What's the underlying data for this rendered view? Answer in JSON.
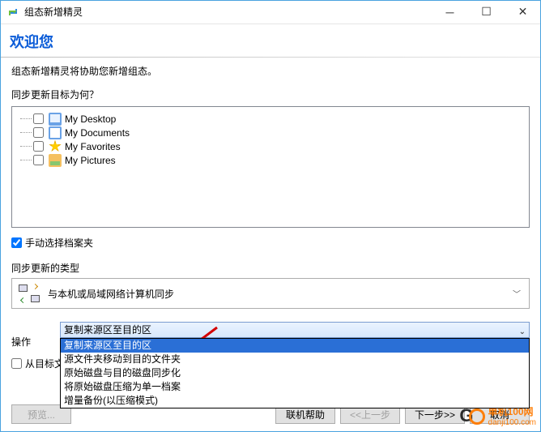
{
  "titlebar": {
    "title": "组态新增精灵"
  },
  "header": {
    "welcome": "欢迎您"
  },
  "intro": "组态新增精灵将协助您新增组态。",
  "section1_label": "同步更新目标为何？",
  "tree": [
    {
      "label": "My Desktop",
      "icon": "desktop"
    },
    {
      "label": "My Documents",
      "icon": "docs"
    },
    {
      "label": "My Favorites",
      "icon": "fav"
    },
    {
      "label": "My Pictures",
      "icon": "pics"
    }
  ],
  "manual_select": {
    "label": "手动选择档案夹",
    "checked": true
  },
  "section2_label": "同步更新的类型",
  "sync_type": {
    "text": "与本机或局域网络计算机同步"
  },
  "operation_label": "操作",
  "combo": {
    "selected": "复制来源区至目的区",
    "options": [
      "复制来源区至目的区",
      "源文件夹移动到目的文件夹",
      "原始磁盘与目的磁盘同步化",
      "将原始磁盘压缩为单一档案",
      "增量备份(以压缩模式)"
    ]
  },
  "lower_checkbox_partial": "从目标文",
  "buttons": {
    "preview": "预览...",
    "help": "联机帮助",
    "back": "<<上一步",
    "next": "下一步>>",
    "cancel": "取消"
  },
  "watermark": {
    "brand_top": "单机100网",
    "brand_bot": "danji100.com"
  }
}
